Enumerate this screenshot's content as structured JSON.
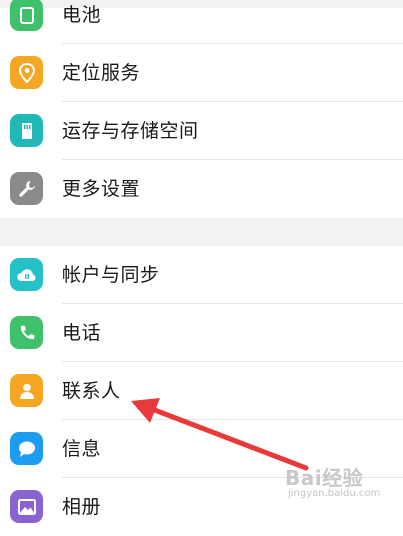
{
  "settings": {
    "items": [
      {
        "label": "电池",
        "icon": "battery-icon",
        "color": "#3fc16b"
      },
      {
        "label": "定位服务",
        "icon": "location-icon",
        "color": "#f5a623"
      },
      {
        "label": "运存与存储空间",
        "icon": "storage-icon",
        "color": "#22b8b8"
      },
      {
        "label": "更多设置",
        "icon": "wrench-icon",
        "color": "#8a8a8a"
      },
      {
        "label": "帐户与同步",
        "icon": "cloud-sync-icon",
        "color": "#25c0c8"
      },
      {
        "label": "电话",
        "icon": "phone-icon",
        "color": "#3fc16b"
      },
      {
        "label": "联系人",
        "icon": "contacts-icon",
        "color": "#f5a623"
      },
      {
        "label": "信息",
        "icon": "message-icon",
        "color": "#1e9df0"
      },
      {
        "label": "相册",
        "icon": "gallery-icon",
        "color": "#8a63d2"
      }
    ]
  },
  "annotation": {
    "arrow_color": "#e83a3a"
  },
  "watermark": {
    "brand": "Bai经验",
    "url": "jingyan.baidu.com"
  }
}
